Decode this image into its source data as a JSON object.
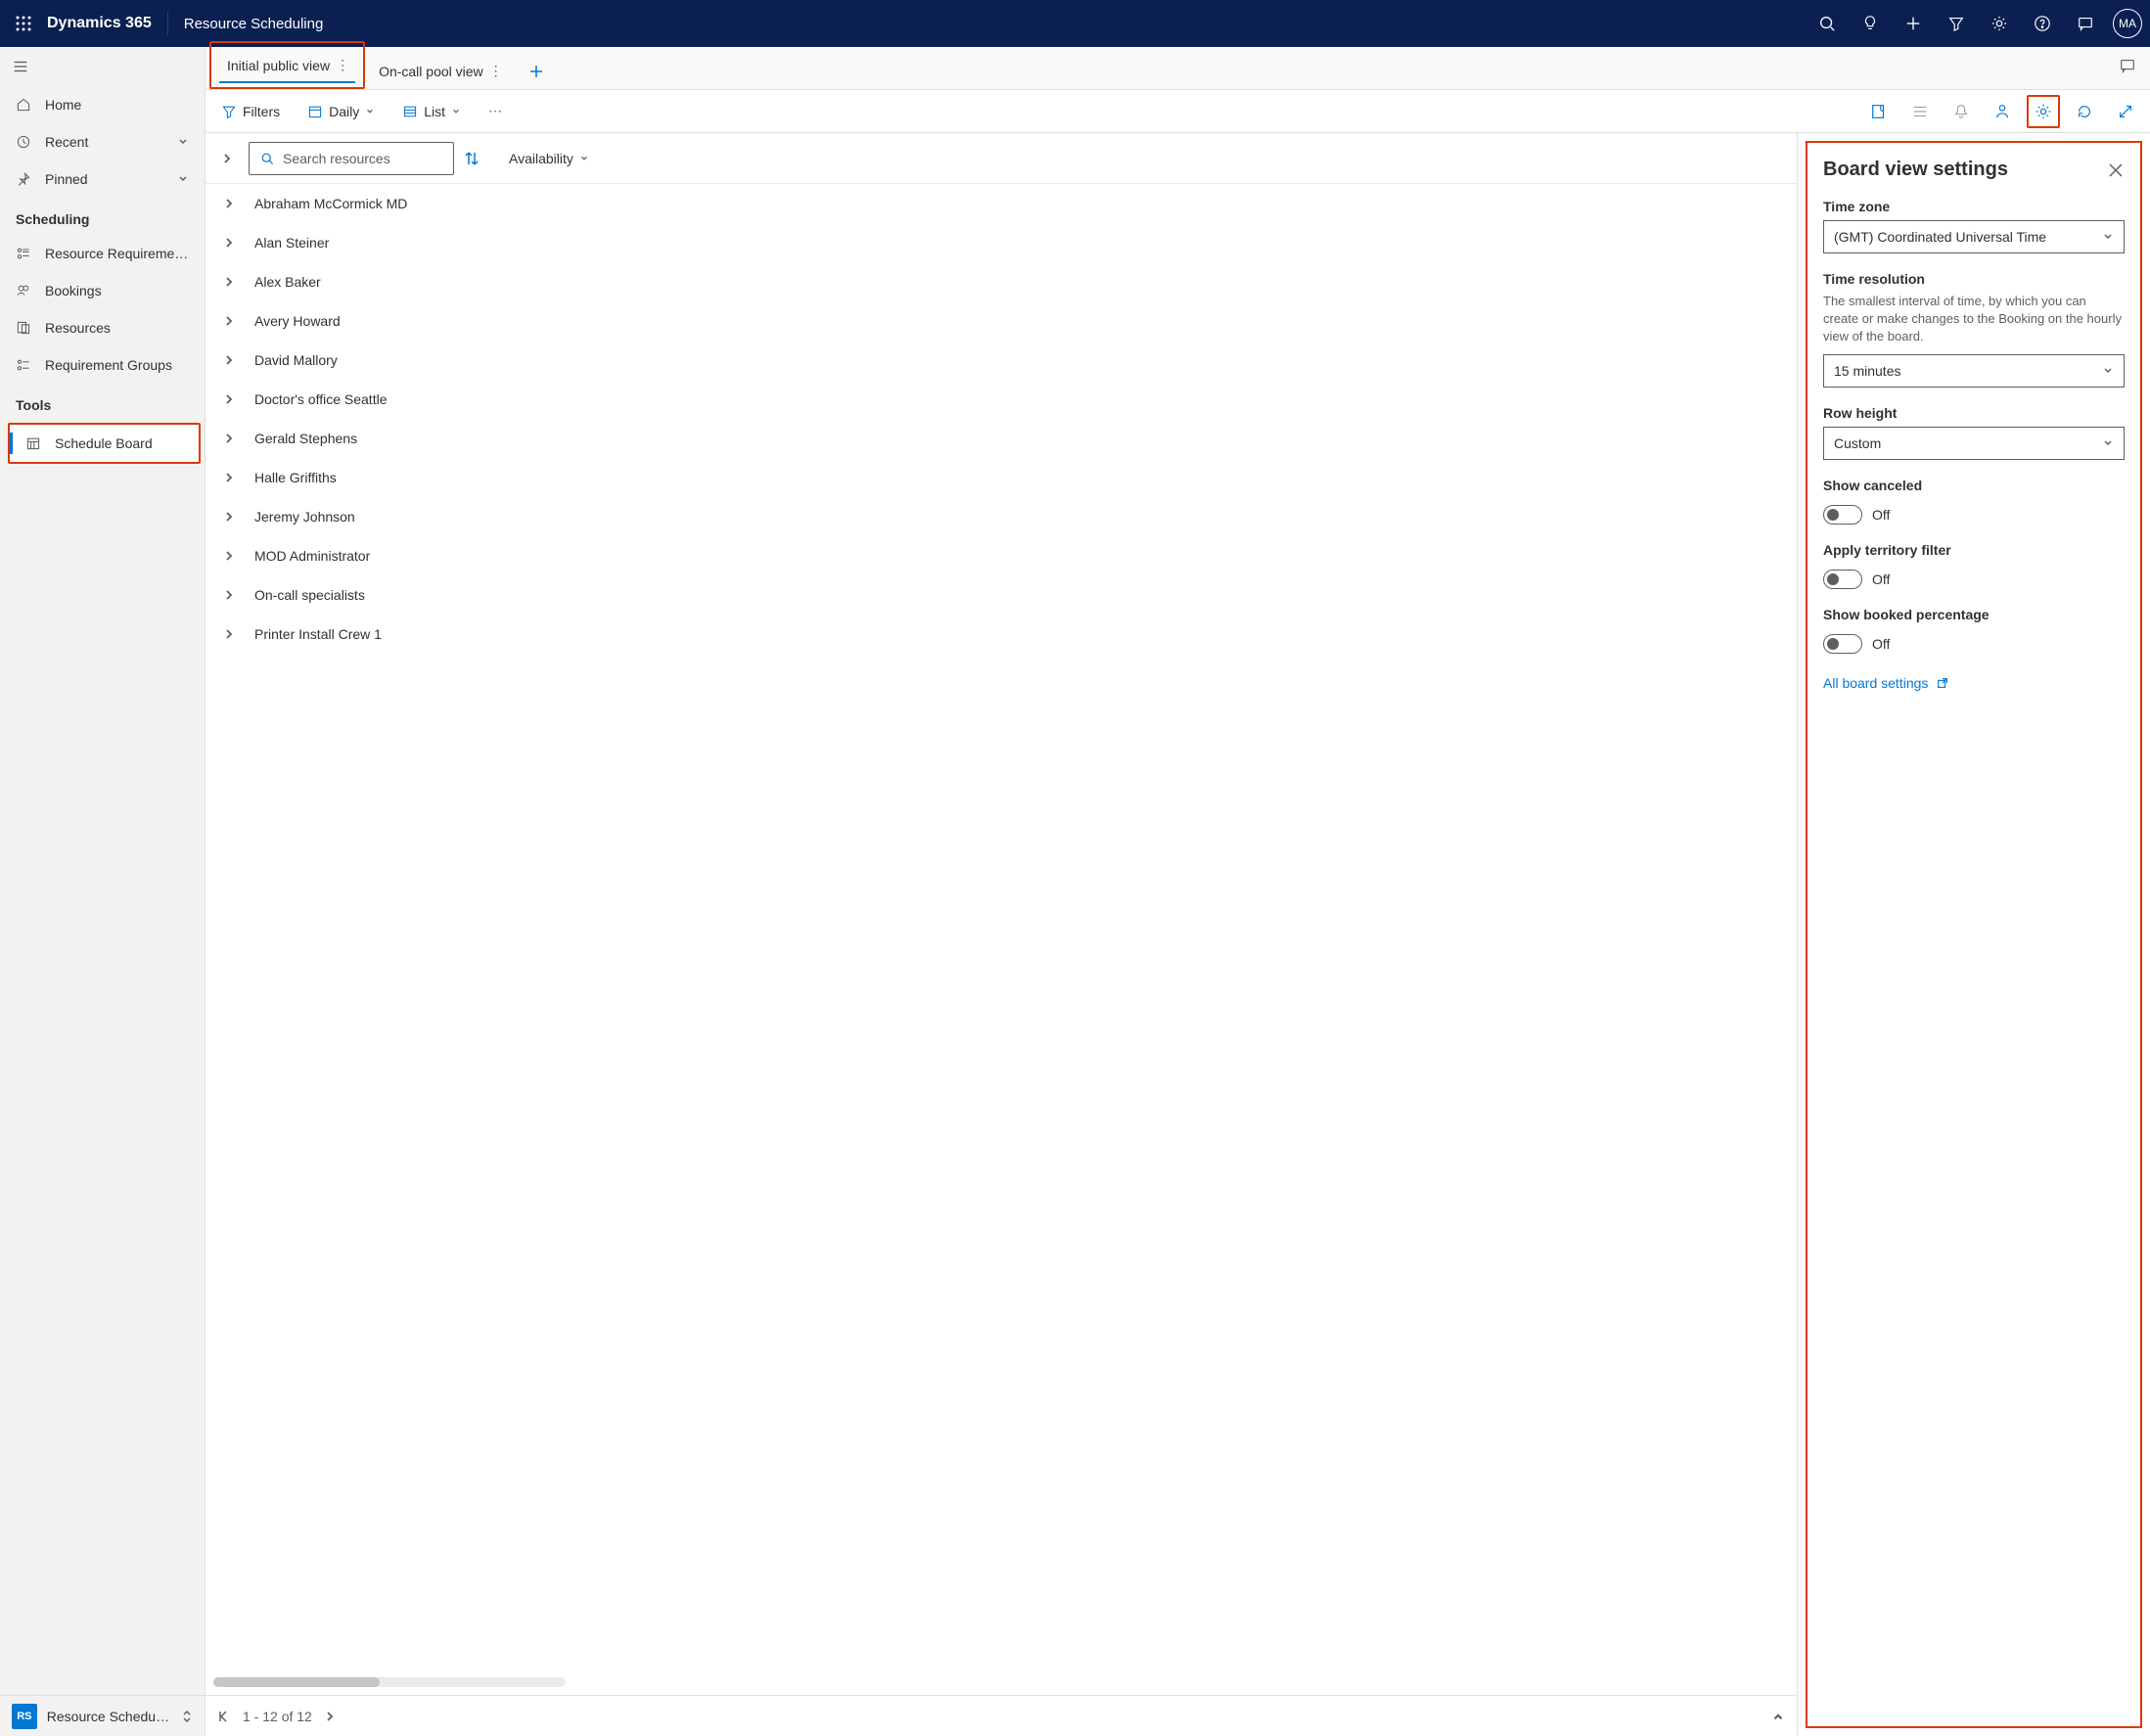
{
  "header": {
    "app_name": "Dynamics 365",
    "area_name": "Resource Scheduling",
    "avatar_initials": "MA"
  },
  "sidebar": {
    "nav": {
      "home": "Home",
      "recent": "Recent",
      "pinned": "Pinned"
    },
    "sections": {
      "scheduling": {
        "label": "Scheduling",
        "items": {
          "resource_requirements": "Resource Requireme…",
          "bookings": "Bookings",
          "resources": "Resources",
          "requirement_groups": "Requirement Groups"
        }
      },
      "tools": {
        "label": "Tools",
        "items": {
          "schedule_board": "Schedule Board"
        }
      }
    },
    "footer": {
      "badge": "RS",
      "label": "Resource Schedul…"
    }
  },
  "tabs": {
    "initial_public_view": "Initial public view",
    "on_call_pool_view": "On-call pool view"
  },
  "toolbar": {
    "filters": "Filters",
    "daily": "Daily",
    "list": "List"
  },
  "search": {
    "placeholder": "Search resources",
    "availability": "Availability"
  },
  "resources": [
    "Abraham McCormick MD",
    "Alan Steiner",
    "Alex Baker",
    "Avery Howard",
    "David Mallory",
    "Doctor's office Seattle",
    "Gerald Stephens",
    "Halle Griffiths",
    "Jeremy Johnson",
    "MOD Administrator",
    "On-call specialists",
    "Printer Install Crew 1"
  ],
  "pager": {
    "range": "1 - 12 of 12"
  },
  "settings_panel": {
    "title": "Board view settings",
    "time_zone": {
      "label": "Time zone",
      "value": "(GMT) Coordinated Universal Time"
    },
    "time_resolution": {
      "label": "Time resolution",
      "help": "The smallest interval of time, by which you can create or make changes to the Booking on the hourly view of the board.",
      "value": "15 minutes"
    },
    "row_height": {
      "label": "Row height",
      "value": "Custom"
    },
    "show_canceled": {
      "label": "Show canceled",
      "value_label": "Off"
    },
    "territory_filter": {
      "label": "Apply territory filter",
      "value_label": "Off"
    },
    "booked_percentage": {
      "label": "Show booked percentage",
      "value_label": "Off"
    },
    "all_settings_link": "All board settings"
  }
}
